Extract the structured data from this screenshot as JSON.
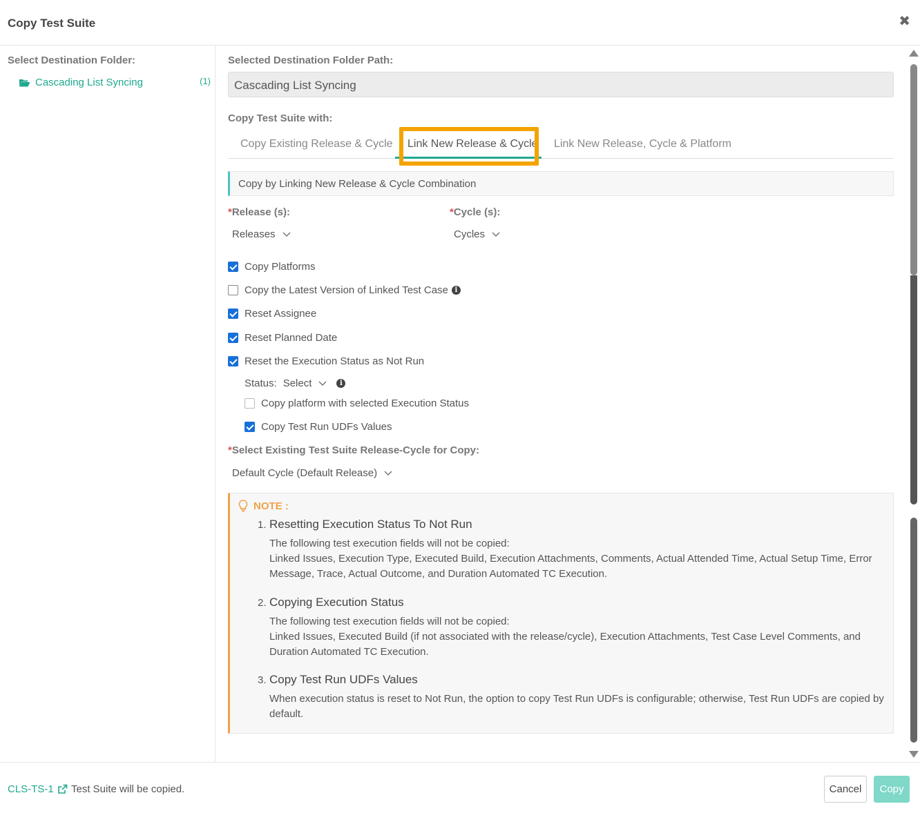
{
  "dialog": {
    "title": "Copy Test Suite",
    "close_icon": "close-icon"
  },
  "sidebar": {
    "label": "Select Destination Folder:",
    "folder": {
      "name": "Cascading List Syncing",
      "count": "(1)",
      "icon": "folder-open-icon"
    }
  },
  "main": {
    "path_label": "Selected Destination Folder Path:",
    "path_value": "Cascading List Syncing",
    "with_label": "Copy Test Suite with:",
    "tabs": [
      {
        "label": "Copy Existing Release & Cycle"
      },
      {
        "label": "Link New Release & Cycle",
        "active": true
      },
      {
        "label": "Link New Release, Cycle & Platform"
      }
    ],
    "info_bar": "Copy by Linking New Release & Cycle Combination",
    "release": {
      "label": "Release (s):",
      "required": "*",
      "value": "Releases"
    },
    "cycle": {
      "label": "Cycle (s):",
      "required": "*",
      "value": "Cycles"
    },
    "options": [
      {
        "label": "Copy Platforms",
        "checked": true
      },
      {
        "label": "Copy the Latest Version of Linked Test Case",
        "checked": false,
        "info": "i"
      },
      {
        "label": "Reset Assignee",
        "checked": true
      },
      {
        "label": "Reset Planned Date",
        "checked": true
      },
      {
        "label": "Reset the Execution Status as Not Run",
        "checked": true
      }
    ],
    "status": {
      "label": "Status:",
      "value": "Select",
      "info": "i"
    },
    "sub_options": [
      {
        "label": "Copy platform with selected Execution Status",
        "checked": false
      },
      {
        "label": "Copy Test Run UDFs Values",
        "checked": true
      }
    ],
    "existing": {
      "label": "Select Existing Test Suite Release-Cycle for Copy:",
      "required": "*",
      "value": "Default Cycle (Default Release)"
    },
    "note": {
      "heading": "NOTE :",
      "items": [
        {
          "num": "1.",
          "title": "Resetting Execution Status To Not Run",
          "line1": "The following test execution fields will not be copied:",
          "line2": "Linked Issues, Execution Type, Executed Build, Execution Attachments, Comments, Actual Attended Time, Actual Setup Time, Error Message, Trace, Actual Outcome, and Duration Automated TC Execution."
        },
        {
          "num": "2.",
          "title": "Copying Execution Status",
          "line1": "The following test execution fields will not be copied:",
          "line2": "Linked Issues, Executed Build (if not associated with the release/cycle), Execution Attachments, Test Case Level Comments, and Duration Automated TC Execution."
        },
        {
          "num": "3.",
          "title": "Copy Test Run UDFs Values",
          "line1": "When execution status is reset to Not Run, the option to copy Test Run UDFs is configurable; otherwise, Test Run UDFs are copied by default."
        }
      ]
    }
  },
  "footer": {
    "id": "CLS-TS-1",
    "message": "Test Suite will be copied.",
    "cancel_label": "Cancel",
    "copy_label": "Copy"
  },
  "colors": {
    "accent": "#1fa88e",
    "highlight": "#f5a300",
    "note": "#f0a24a",
    "checkbox": "#1670d9"
  }
}
